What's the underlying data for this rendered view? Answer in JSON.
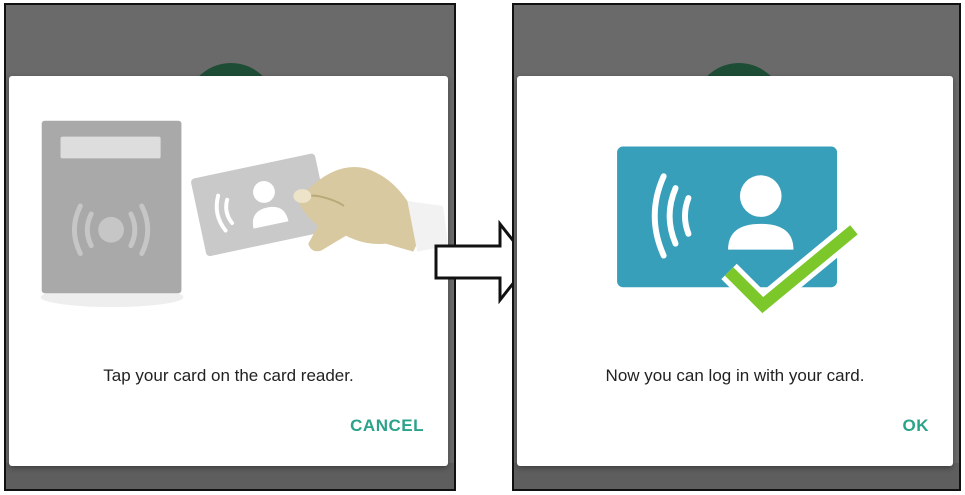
{
  "steps": [
    {
      "id": "tap",
      "message": "Tap your card on the card reader.",
      "button_label": "CANCEL",
      "illustration": "card-reader-tap"
    },
    {
      "id": "done",
      "message": "Now you can log in with your card.",
      "button_label": "OK",
      "illustration": "card-registered-check"
    }
  ],
  "colors": {
    "accent": "#2aa38a",
    "card_blue": "#379fba",
    "check_green": "#7cc72a",
    "overlay": "#6a6a6a"
  }
}
